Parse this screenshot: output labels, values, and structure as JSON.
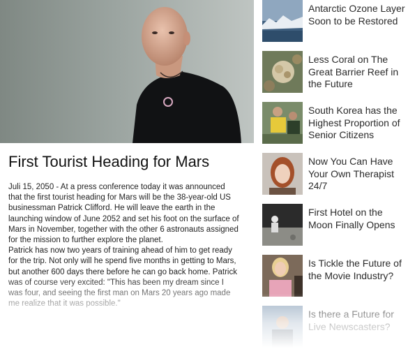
{
  "article": {
    "title": "First Tourist Heading for Mars",
    "paragraphs": [
      "Juli 15, 2050 - At a press conference today it was announced that the first tourist heading for Mars will be the 38-year-old US businessman Patrick Clifford. He will leave the earth in the launching window of June 2052 and set his foot on the surface of Mars in November, together with the other 6 astronauts assigned for the mission to further explore the planet.",
      "Patrick has now two years of training ahead of him to get ready for the trip. Not only will he spend five months in getting to Mars, but another 600 days there before he can go back home. Patrick was of course very excited: \"This has been my dream since I was four, and seeing the first man on Mars 20 years ago made me realize that it was possible.\""
    ]
  },
  "sidebar": {
    "items": [
      {
        "label": "Antarctic Ozone Layer Soon to be Restored",
        "icon": "antarctic-photo"
      },
      {
        "label": "Less Coral on The Great Barrier Reef in the Future",
        "icon": "coral-photo"
      },
      {
        "label": "South Korea has the Highest Proportion of Senior Citizens",
        "icon": "seniors-photo"
      },
      {
        "label": "Now You Can Have Your Own Therapist 24/7",
        "icon": "therapist-photo"
      },
      {
        "label": "First Hotel on the Moon Finally Opens",
        "icon": "moon-photo"
      },
      {
        "label": "Is Tickle the Future of the Movie Industry?",
        "icon": "movie-photo"
      },
      {
        "label": "Is there a Future for Live Newscasters?",
        "icon": "newscaster-photo"
      }
    ]
  }
}
